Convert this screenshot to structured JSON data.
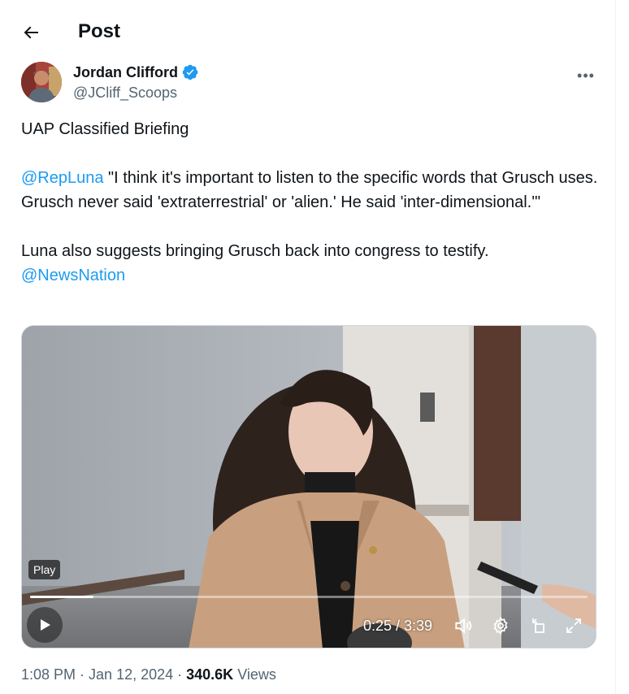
{
  "header": {
    "title": "Post",
    "back_icon": "arrow-left-icon"
  },
  "author": {
    "name": "Jordan Clifford",
    "handle": "@JCliff_Scoops",
    "verified_color": "#1d9bf0",
    "more_icon": "more-horizontal-icon",
    "more_label": "•••"
  },
  "tweet": {
    "line1": "UAP Classified Briefing",
    "mention1": "@RepLuna",
    "quote": " \"I think it's important to listen to the specific words that Grusch uses. Grusch never said 'extraterrestrial' or 'alien.' He said 'inter-dimensional.'\"",
    "line3": "Luna also suggests bringing Grusch back into congress to testify.",
    "mention2": "@NewsNation"
  },
  "video": {
    "tooltip": "Play",
    "time": "0:25 / 3:39",
    "progress": 0.114,
    "icons": [
      "play-icon",
      "volume-icon",
      "settings-gear-icon",
      "rotate-icon",
      "fullscreen-icon"
    ]
  },
  "meta": {
    "time": "1:08 PM",
    "separator1": " · ",
    "date": "Jan 12, 2024",
    "separator2": " · ",
    "views_count": "340.6K",
    "views_label": " Views"
  },
  "colors": {
    "accent": "#1d9bf0",
    "text": "#0f1419",
    "secondary": "#536471"
  }
}
